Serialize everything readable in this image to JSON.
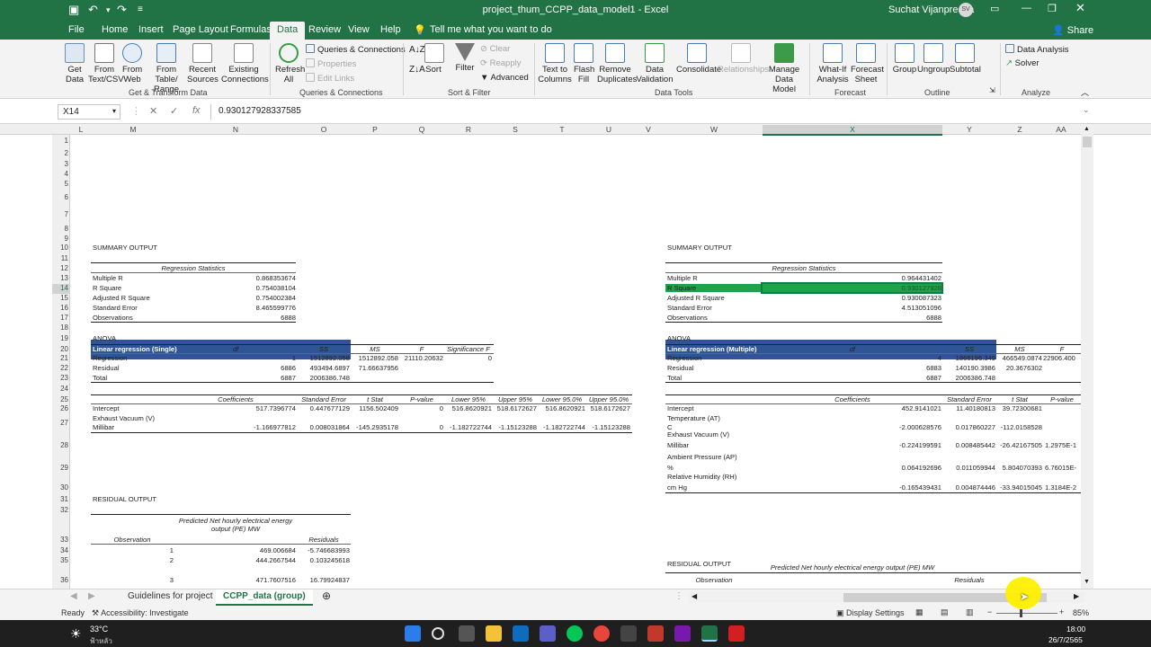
{
  "title_bar": {
    "title": "project_thum_CCPP_data_model1  -  Excel",
    "user": "Suchat Vijanprecha",
    "avatar_initials": "SV"
  },
  "tabs": [
    "File",
    "Home",
    "Insert",
    "Page Layout",
    "Formulas",
    "Data",
    "Review",
    "View",
    "Help"
  ],
  "active_tab": "Data",
  "tell_me": "Tell me what you want to do",
  "share": "Share",
  "ribbon": {
    "get_data": "Get Data",
    "from_text_csv": "From Text/CSV",
    "from_web": "From Web",
    "from_table_range": "From Table/ Range",
    "recent_sources": "Recent Sources",
    "existing_connections": "Existing Connections",
    "group_get_transform": "Get & Transform Data",
    "refresh_all": "Refresh All",
    "queries_connections": "Queries & Connections",
    "properties": "Properties",
    "edit_links": "Edit Links",
    "group_queries": "Queries & Connections",
    "sort": "Sort",
    "filter": "Filter",
    "clear": "Clear",
    "reapply": "Reapply",
    "advanced": "Advanced",
    "group_sort_filter": "Sort & Filter",
    "text_to_columns": "Text to Columns",
    "flash_fill": "Flash Fill",
    "remove_duplicates": "Remove Duplicates",
    "data_validation": "Data Validation",
    "consolidate": "Consolidate",
    "relationships": "Relationships",
    "manage_data_model": "Manage Data Model",
    "group_data_tools": "Data Tools",
    "what_if": "What-If Analysis",
    "forecast_sheet": "Forecast Sheet",
    "group_forecast": "Forecast",
    "group": "Group",
    "ungroup": "Ungroup",
    "subtotal": "Subtotal",
    "group_outline": "Outline",
    "data_analysis": "Data Analysis",
    "solver": "Solver",
    "group_analyze": "Analyze"
  },
  "formula_bar": {
    "name_box": "X14",
    "formula": "0.930127928337585",
    "fx": "fx"
  },
  "columns": [
    "L",
    "M",
    "N",
    "O",
    "P",
    "Q",
    "R",
    "S",
    "T",
    "U",
    "V",
    "W",
    "X",
    "Y",
    "Z",
    "AA"
  ],
  "selected_column": "X",
  "rows": [
    "1",
    "2",
    "3",
    "4",
    "5",
    "6",
    "7",
    "8",
    "9",
    "10",
    "11",
    "12",
    "13",
    "14",
    "15",
    "16",
    "17",
    "18",
    "19",
    "20",
    "21",
    "22",
    "23",
    "24",
    "25",
    "26",
    "27",
    "28",
    "29",
    "30",
    "31",
    "32",
    "33",
    "34",
    "35",
    "36"
  ],
  "selected_row": "14",
  "single": {
    "header": "Linear regression (Single)",
    "summary_output": "SUMMARY OUTPUT",
    "reg_stats_title": "Regression Statistics",
    "reg_stats": [
      {
        "label": "Multiple R",
        "value": "0.868353674"
      },
      {
        "label": "R Square",
        "value": "0.754038104"
      },
      {
        "label": "Adjusted R Square",
        "value": "0.754002384"
      },
      {
        "label": "Standard Error",
        "value": "8.465599776"
      },
      {
        "label": "Observations",
        "value": "6888"
      }
    ],
    "anova": "ANOVA",
    "anova_headers": [
      "df",
      "SS",
      "MS",
      "F",
      "Significance F"
    ],
    "anova_rows": [
      {
        "label": "Regression",
        "df": "1",
        "ss": "1512892.058",
        "ms": "1512892.058",
        "f": "21110.20632",
        "sig": "0"
      },
      {
        "label": "Residual",
        "df": "6886",
        "ss": "493494.6897",
        "ms": "71.66637956",
        "f": "",
        "sig": ""
      },
      {
        "label": "Total",
        "df": "6887",
        "ss": "2006386.748",
        "ms": "",
        "f": "",
        "sig": ""
      }
    ],
    "coef_headers": [
      "Coefficients",
      "Standard Error",
      "t Stat",
      "P-value",
      "Lower 95%",
      "Upper 95%",
      "Lower 95.0%",
      "Upper 95.0%"
    ],
    "intercept": {
      "label": "Intercept",
      "coef": "517.7396774",
      "se": "0.447677129",
      "t": "1156.502409",
      "p": "0",
      "l95": "516.8620921",
      "u95": "518.6172627",
      "l950": "516.8620921",
      "u950": "518.6172627"
    },
    "exhaust_label1": "Exhaust Vacuum (V)",
    "exhaust": {
      "label": "Millibar",
      "coef": "-1.166977812",
      "se": "0.008031864",
      "t": "-145.2935178",
      "p": "0",
      "l95": "-1.182722744",
      "u95": "-1.15123288",
      "l950": "-1.182722744",
      "u950": "-1.15123288"
    },
    "residual_output": "RESIDUAL OUTPUT",
    "resid_pred_header": "Predicted Net hourly electrical energy output (PE) MW",
    "resid_obs_header": "Observation",
    "resid_res_header": "Residuals",
    "residuals": [
      {
        "obs": "1",
        "pred": "469.006684",
        "res": "-5.746683993"
      },
      {
        "obs": "2",
        "pred": "444.2667544",
        "res": "0.103245618"
      },
      {
        "obs": "3",
        "pred": "471.7607516",
        "res": "16.79924837"
      }
    ]
  },
  "multiple": {
    "header": "Linear regression (Multiple)",
    "summary_output": "SUMMARY OUTPUT",
    "reg_stats_title": "Regression Statistics",
    "reg_stats": [
      {
        "label": "Multiple R",
        "value": "0.964431402"
      },
      {
        "label": "R Square",
        "value": "0.930127928"
      },
      {
        "label": "Adjusted R Square",
        "value": "0.930087323"
      },
      {
        "label": "Standard Error",
        "value": "4.513051096"
      },
      {
        "label": "Observations",
        "value": "6888"
      }
    ],
    "anova": "ANOVA",
    "anova_headers": [
      "df",
      "SS",
      "MS",
      "F"
    ],
    "anova_rows": [
      {
        "label": "Regression",
        "df": "4",
        "ss": "1866196.349",
        "ms": "466549.0874",
        "f": "22906.400"
      },
      {
        "label": "Residual",
        "df": "6883",
        "ss": "140190.3986",
        "ms": "20.3676302",
        "f": ""
      },
      {
        "label": "Total",
        "df": "6887",
        "ss": "2006386.748",
        "ms": "",
        "f": ""
      }
    ],
    "coef_headers": [
      "Coefficients",
      "Standard Error",
      "t Stat",
      "P-value"
    ],
    "intercept": {
      "label": "Intercept",
      "coef": "452.9141021",
      "se": "11.40180813",
      "t": "39.72300681",
      "p": ""
    },
    "temp_label1": "Temperature (AT)",
    "temp": {
      "label": "C",
      "coef": "-2.000628576",
      "se": "0.017860227",
      "t": "-112.0158528",
      "p": ""
    },
    "exh_label1": "Exhaust Vacuum (V)",
    "exh": {
      "label": "Millibar",
      "coef": "-0.224199591",
      "se": "0.008485442",
      "t": "-26.42167505",
      "p": "1.2975E-1"
    },
    "amb_label1": "Ambient Pressure (AP)",
    "amb": {
      "label": "%",
      "coef": "0.064192696",
      "se": "0.011059944",
      "t": "5.804070393",
      "p": "6.76015E-"
    },
    "rh_label1": "Relative Humidity (RH)",
    "rh": {
      "label": "cm Hg",
      "coef": "-0.165439431",
      "se": "0.004874446",
      "t": "-33.94015045",
      "p": "1.3184E-2"
    },
    "residual_output": "RESIDUAL OUTPUT",
    "resid_pred_header": "Predicted Net hourly electrical energy output (PE) MW",
    "resid_obs_header": "Observation",
    "resid_res_header": "Residuals"
  },
  "sheets": [
    "Guidelines for project",
    "CCPP_data (group)"
  ],
  "active_sheet": "CCPP_data (group)",
  "status": {
    "ready": "Ready",
    "accessibility": "Accessibility: Investigate",
    "display_settings": "Display Settings",
    "zoom": "85%"
  },
  "taskbar": {
    "temp": "33°C",
    "weather": "ฟ้าหลัว",
    "time": "18:00",
    "date": "26/7/2565"
  },
  "colors": {
    "excel_green": "#217346",
    "header_blue": "#2f5597",
    "selection_green": "#1fa34a",
    "cursor_yellow": "#ffef00"
  }
}
